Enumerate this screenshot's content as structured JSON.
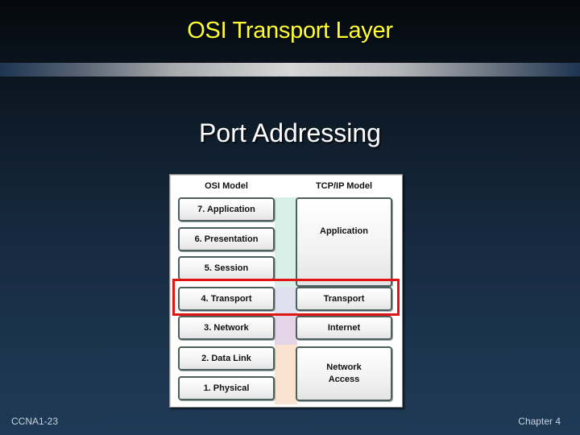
{
  "slide": {
    "title": "OSI Transport Layer",
    "subtitle": "Port Addressing",
    "footer_left": "CCNA1-23",
    "footer_right": "Chapter 4"
  },
  "diagram": {
    "osi_header": "OSI Model",
    "tcpip_header": "TCP/IP Model",
    "osi_layers": [
      "7. Application",
      "6. Presentation",
      "5. Session",
      "4. Transport",
      "3. Network",
      "2. Data Link",
      "1. Physical"
    ],
    "tcpip_layers": [
      "Application",
      "Transport",
      "Internet",
      "Network Access"
    ],
    "highlighted_layer": "Transport",
    "colors": {
      "highlight": "#e01414",
      "band_application": "#d8efe7",
      "band_transport": "#dfe0f0",
      "band_internet": "#e4d4e8",
      "band_network_access": "#fbe3d2",
      "title": "#ffff33"
    }
  }
}
